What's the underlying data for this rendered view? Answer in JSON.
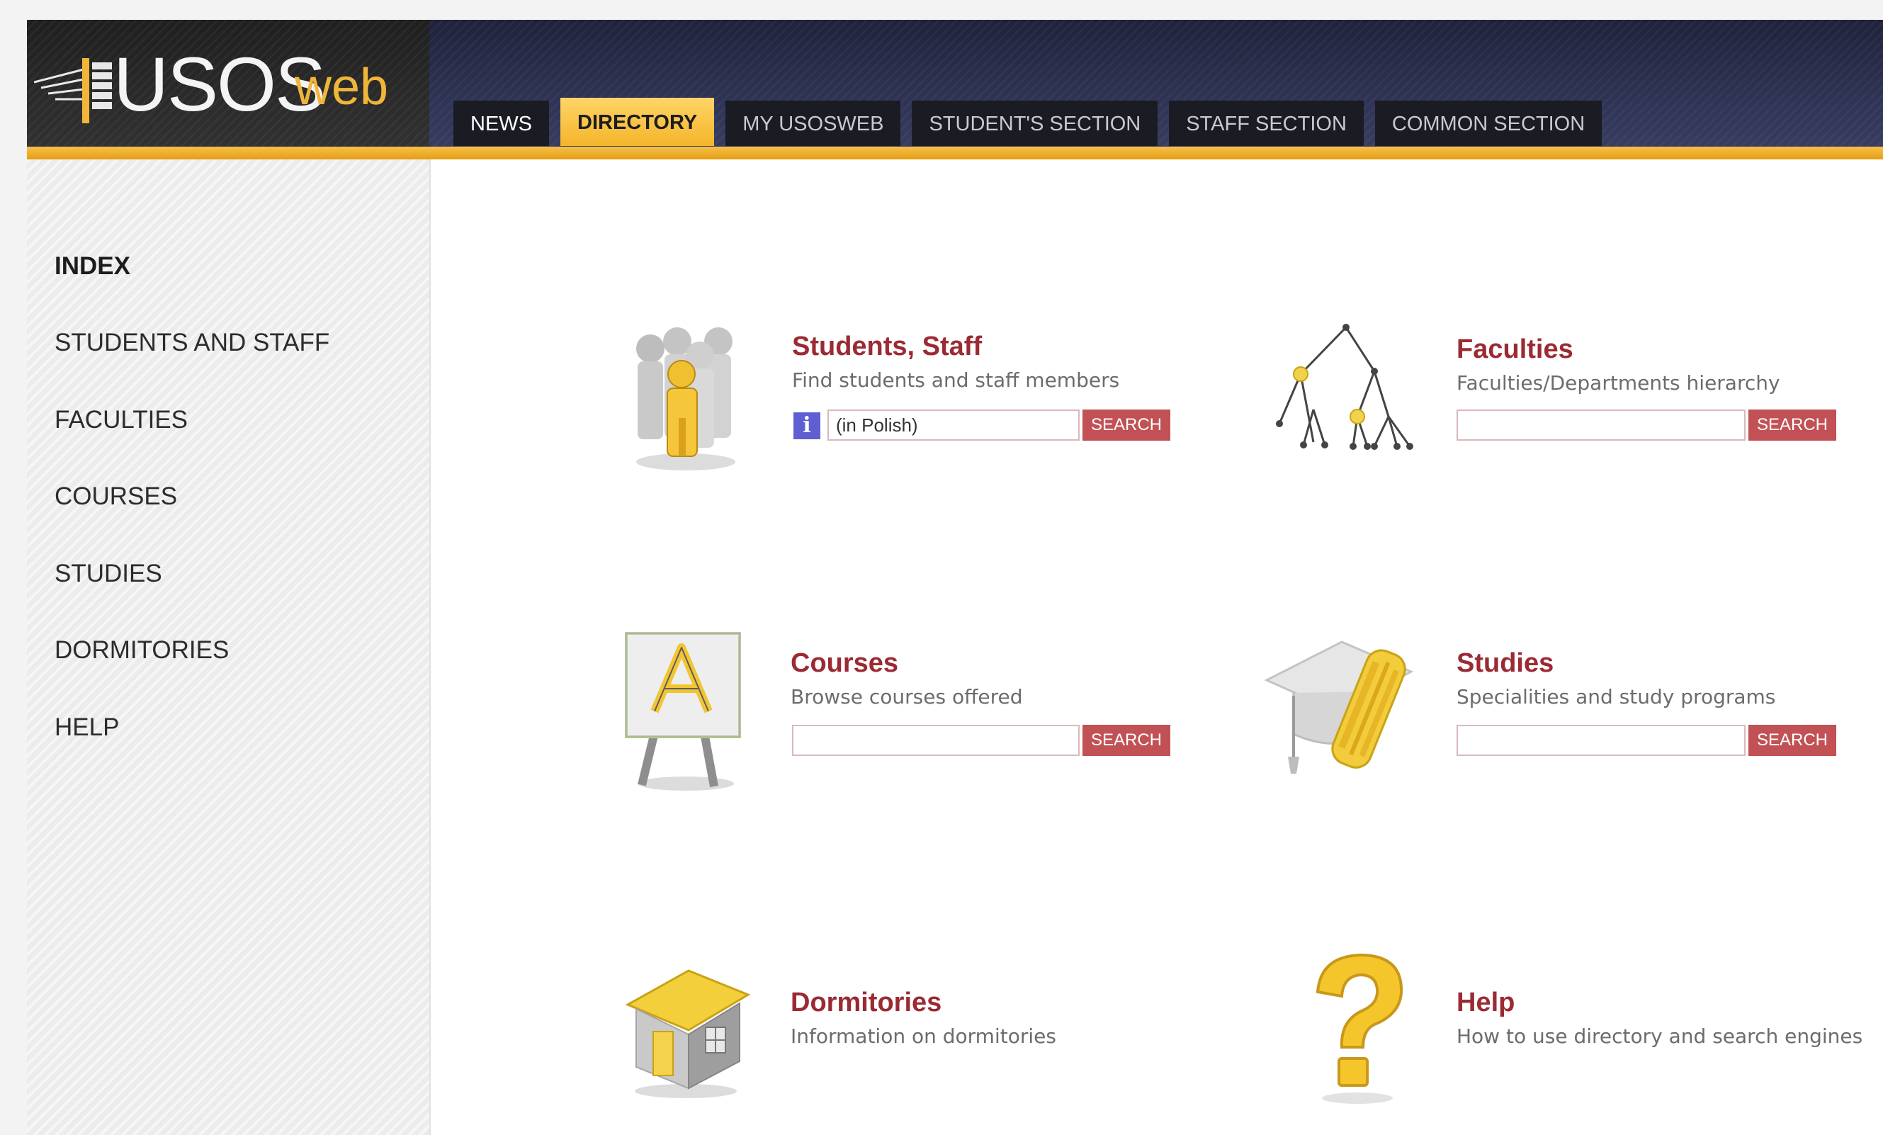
{
  "app": {
    "logo_main": "USOS",
    "logo_sub": "web"
  },
  "colors": {
    "accent": "#f4b52c",
    "title_red": "#9b2a33",
    "search_button": "#c15155",
    "info_blue": "#5f5fd1"
  },
  "nav": {
    "tabs": [
      {
        "label": "NEWS"
      },
      {
        "label": "DIRECTORY",
        "active": true
      },
      {
        "label": "MY USOSWEB"
      },
      {
        "label": "STUDENT'S SECTION"
      },
      {
        "label": "STAFF SECTION"
      },
      {
        "label": "COMMON SECTION"
      }
    ]
  },
  "sidebar": {
    "items": [
      {
        "label": "INDEX",
        "active": true
      },
      {
        "label": "STUDENTS AND STAFF"
      },
      {
        "label": "FACULTIES"
      },
      {
        "label": "COURSES"
      },
      {
        "label": "STUDIES"
      },
      {
        "label": "DORMITORIES"
      },
      {
        "label": "HELP"
      }
    ]
  },
  "cards": {
    "students": {
      "title": "Students, Staff",
      "subtitle": "Find students and staff members",
      "icon": "people-icon",
      "info_label": "i",
      "input_value": "(in Polish)",
      "search_label": "SEARCH"
    },
    "faculties": {
      "title": "Faculties",
      "subtitle": "Faculties/Departments hierarchy",
      "icon": "hierarchy-tree-icon",
      "input_value": "",
      "search_label": "SEARCH"
    },
    "courses": {
      "title": "Courses",
      "subtitle": "Browse courses offered",
      "icon": "easel-icon",
      "input_value": "",
      "search_label": "SEARCH"
    },
    "studies": {
      "title": "Studies",
      "subtitle": "Specialities and study programs",
      "icon": "graduation-cap-icon",
      "input_value": "",
      "search_label": "SEARCH"
    },
    "dormitories": {
      "title": "Dormitories",
      "subtitle": "Information on dormitories",
      "icon": "house-icon"
    },
    "help": {
      "title": "Help",
      "subtitle": "How to use directory and search engines",
      "icon": "question-mark-icon"
    }
  }
}
